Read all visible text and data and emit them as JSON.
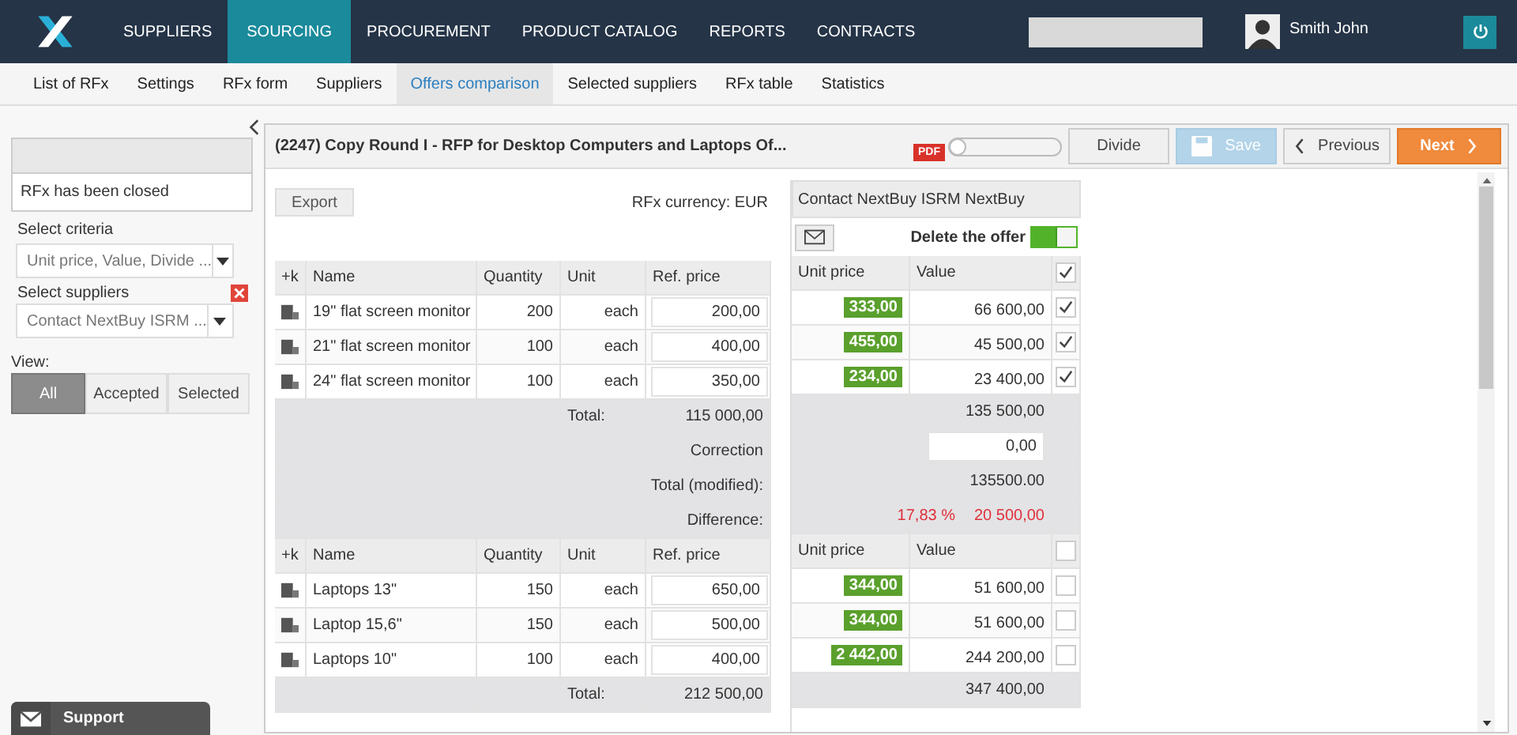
{
  "nav": [
    {
      "label": "SUPPLIERS",
      "selected": false
    },
    {
      "label": "SOURCING",
      "selected": true
    },
    {
      "label": "PROCUREMENT",
      "selected": false
    },
    {
      "label": "PRODUCT CATALOG",
      "selected": false
    },
    {
      "label": "REPORTS",
      "selected": false
    },
    {
      "label": "CONTRACTS",
      "selected": false
    }
  ],
  "user": {
    "name": "Smith John"
  },
  "subnav": [
    {
      "label": "List of RFx",
      "selected": false
    },
    {
      "label": "Settings",
      "selected": false
    },
    {
      "label": "RFx form",
      "selected": false
    },
    {
      "label": "Suppliers",
      "selected": false
    },
    {
      "label": "Offers comparison",
      "selected": true
    },
    {
      "label": "Selected suppliers",
      "selected": false
    },
    {
      "label": "RFx table",
      "selected": false
    },
    {
      "label": "Statistics",
      "selected": false
    }
  ],
  "sidebar": {
    "status": "RFx has been closed",
    "criteria_label": "Select criteria",
    "criteria_value": "Unit price, Value, Divide ...",
    "suppliers_label": "Select suppliers",
    "suppliers_value": "Contact NextBuy ISRM ...",
    "view_label": "View:",
    "view_options": [
      {
        "label": "All",
        "selected": true
      },
      {
        "label": "Accepted",
        "selected": false
      },
      {
        "label": "Selected",
        "selected": false
      }
    ]
  },
  "support": "Support",
  "rfx": {
    "title": "(2247) Copy Round I - RFP for Desktop Computers and Laptops Of...",
    "pdf": "PDF",
    "divide": "Divide",
    "save": "Save",
    "save_disabled": true,
    "previous": "Previous",
    "next": "Next",
    "export": "Export",
    "currency": "RFx currency: EUR"
  },
  "supplier": {
    "name": "Contact NextBuy ISRM NextBuy",
    "delete_label": "Delete the offer",
    "delete_on": true
  },
  "groups": [
    {
      "columns": [
        "+k",
        "Name",
        "Quantity",
        "Unit",
        "Ref. price"
      ],
      "offer_columns": [
        "Unit price",
        "Value"
      ],
      "all_checked": true,
      "items": [
        {
          "name": "19\" flat screen monitor",
          "quantity": "200",
          "unit": "each",
          "ref_price": "200,00",
          "unit_price": "333,00",
          "value": "66 600,00",
          "checked": true
        },
        {
          "name": "21\" flat screen monitor",
          "quantity": "100",
          "unit": "each",
          "ref_price": "400,00",
          "unit_price": "455,00",
          "value": "45 500,00",
          "checked": true
        },
        {
          "name": "24\" flat screen monitor",
          "quantity": "100",
          "unit": "each",
          "ref_price": "350,00",
          "unit_price": "234,00",
          "value": "23 400,00",
          "checked": true
        }
      ],
      "total_label": "Total:",
      "total": "115 000,00",
      "offer_total": "135 500,00",
      "summary": {
        "correction_label": "Correction",
        "correction_value": "0,00",
        "modified_label": "Total (modified):",
        "modified_value": "135500.00",
        "difference_label": "Difference:",
        "difference_percent": "17,83 %",
        "difference_value": "20 500,00"
      }
    },
    {
      "columns": [
        "+k",
        "Name",
        "Quantity",
        "Unit",
        "Ref. price"
      ],
      "offer_columns": [
        "Unit price",
        "Value"
      ],
      "all_checked": false,
      "items": [
        {
          "name": "Laptops 13\"",
          "quantity": "150",
          "unit": "each",
          "ref_price": "650,00",
          "unit_price": "344,00",
          "value": "51 600,00",
          "checked": false
        },
        {
          "name": "Laptop 15,6\"",
          "quantity": "150",
          "unit": "each",
          "ref_price": "500,00",
          "unit_price": "344,00",
          "value": "51 600,00",
          "checked": false
        },
        {
          "name": "Laptops 10\"",
          "quantity": "100",
          "unit": "each",
          "ref_price": "400,00",
          "unit_price": "2 442,00",
          "value": "244 200,00",
          "checked": false
        }
      ],
      "total_label": "Total:",
      "total": "212 500,00",
      "offer_total": "347 400,00"
    }
  ]
}
